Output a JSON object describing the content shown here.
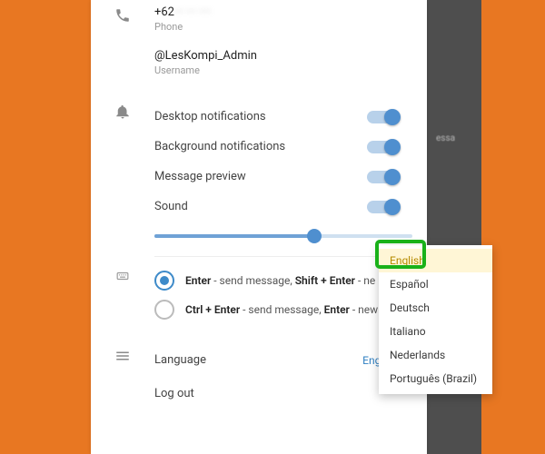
{
  "contact": {
    "phone_prefix": "+62",
    "phone_hidden": "··· ··· ····",
    "phone_label": "Phone",
    "username": "@LesKompi_Admin",
    "username_label": "Username"
  },
  "notifications": {
    "desktop": "Desktop notifications",
    "background": "Background notifications",
    "preview": "Message preview",
    "sound": "Sound"
  },
  "send": {
    "opt1_a": "Enter",
    "opt1_b": " - send message, ",
    "opt1_c": "Shift + Enter",
    "opt1_d": " - ne",
    "opt2_a": "Ctrl + Enter",
    "opt2_b": " - send message, ",
    "opt2_c": "Enter",
    "opt2_d": " - new"
  },
  "language": {
    "label": "Language",
    "current": "English",
    "options": [
      "English",
      "Español",
      "Deutsch",
      "Italiano",
      "Nederlands",
      "Português (Brazil)"
    ]
  },
  "logout": "Log out",
  "bg_hint": "essa"
}
